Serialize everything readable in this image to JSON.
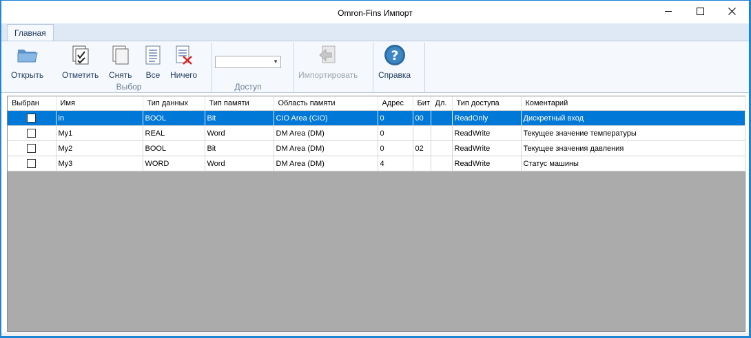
{
  "window": {
    "title": "Omron-Fins Импорт",
    "minimize_icon": "minimize-icon",
    "maximize_icon": "maximize-icon",
    "close_icon": "close-icon"
  },
  "ribbon": {
    "tab": "Главная",
    "open": "Открыть",
    "mark": "Отметить",
    "unmark": "Снять",
    "all": "Все",
    "none": "Ничего",
    "group_select": "Выбор",
    "access_value": "",
    "group_access": "Доступ",
    "import": "Импортировать",
    "help": "Справка"
  },
  "grid": {
    "columns": [
      "Выбран",
      "Имя",
      "Тип данных",
      "Тип памяти",
      "Область памяти",
      "Адрес",
      "Бит",
      "Дл.",
      "Тип доступа",
      "Коментарий"
    ],
    "rows": [
      {
        "selected": false,
        "name": "in",
        "data_type": "BOOL",
        "mem_type": "Bit",
        "area": "CIO Area (CIO)",
        "address": "0",
        "bit": "00",
        "len": "",
        "access": "ReadOnly",
        "comment": "Дискретный вход"
      },
      {
        "selected": false,
        "name": "My1",
        "data_type": "REAL",
        "mem_type": "Word",
        "area": "DM Area (DM)",
        "address": "0",
        "bit": "",
        "len": "",
        "access": "ReadWrite",
        "comment": "Текущее значение температуры"
      },
      {
        "selected": false,
        "name": "My2",
        "data_type": "BOOL",
        "mem_type": "Bit",
        "area": "DM Area (DM)",
        "address": "0",
        "bit": "02",
        "len": "",
        "access": "ReadWrite",
        "comment": "Текущее значения давления"
      },
      {
        "selected": false,
        "name": "My3",
        "data_type": "WORD",
        "mem_type": "Word",
        "area": "DM Area (DM)",
        "address": "4",
        "bit": "",
        "len": "",
        "access": "ReadWrite",
        "comment": "Статус машины"
      }
    ]
  }
}
